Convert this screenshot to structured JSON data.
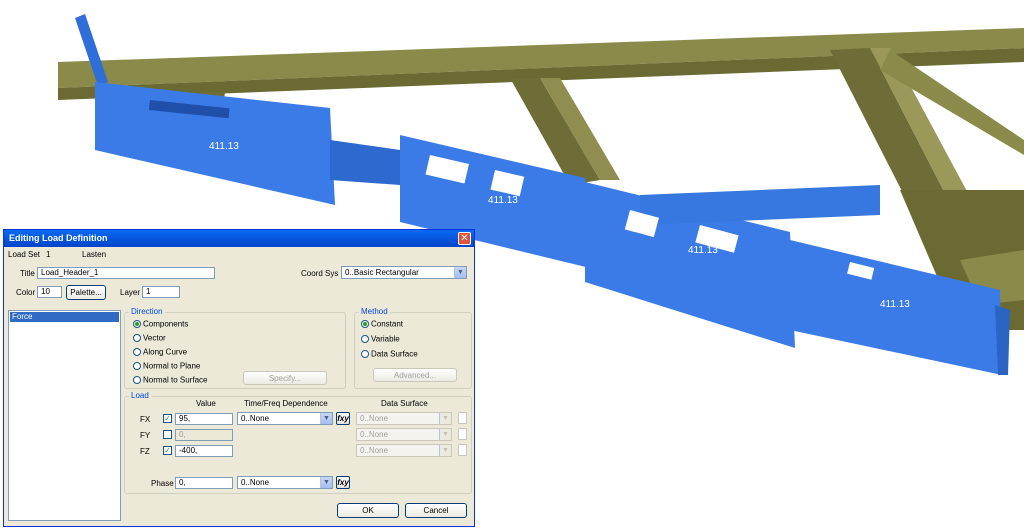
{
  "scene": {
    "labels": [
      "411.13",
      "411.13",
      "411.13",
      "411.13"
    ],
    "colors": {
      "beam": "#7e7d43",
      "panel": "#3b7be8",
      "background": "#ffffff"
    }
  },
  "dialog": {
    "title": "Editing Load Definition",
    "close_icon": "close-icon",
    "load_set_label": "Load Set",
    "load_set_value": "1",
    "load_set_name": "Lasten",
    "title_label": "Title",
    "title_value": "Load_Header_1",
    "coord_sys_label": "Coord Sys",
    "coord_sys_value": "0..Basic Rectangular",
    "color_label": "Color",
    "color_value": "10",
    "palette_button": "Palette...",
    "layer_label": "Layer",
    "layer_value": "1",
    "list_items": [
      "Force"
    ],
    "direction": {
      "title": "Direction",
      "options": [
        "Components",
        "Vector",
        "Along Curve",
        "Normal to Plane",
        "Normal to Surface"
      ],
      "selected": "Components",
      "specify_button": "Specify..."
    },
    "method": {
      "title": "Method",
      "options": [
        "Constant",
        "Variable",
        "Data Surface"
      ],
      "selected": "Constant",
      "advanced_button": "Advanced..."
    },
    "load": {
      "title": "Load",
      "col_value": "Value",
      "col_time": "Time/Freq Dependence",
      "col_surface": "Data Surface",
      "rows": [
        {
          "label": "FX",
          "checked": true,
          "value": "95,",
          "time": "0..None",
          "surface": "0..None"
        },
        {
          "label": "FY",
          "checked": false,
          "value": "0,",
          "time": "",
          "surface": "0..None"
        },
        {
          "label": "FZ",
          "checked": true,
          "value": "-400,",
          "time": "",
          "surface": "0..None"
        }
      ],
      "phase_label": "Phase",
      "phase_value": "0,",
      "phase_time": "0..None",
      "fxy_label": "fxy"
    },
    "ok_button": "OK",
    "cancel_button": "Cancel",
    "colors": {
      "titlebar": "#0453d9",
      "face": "#ece9d8",
      "selection": "#316ac5"
    }
  }
}
